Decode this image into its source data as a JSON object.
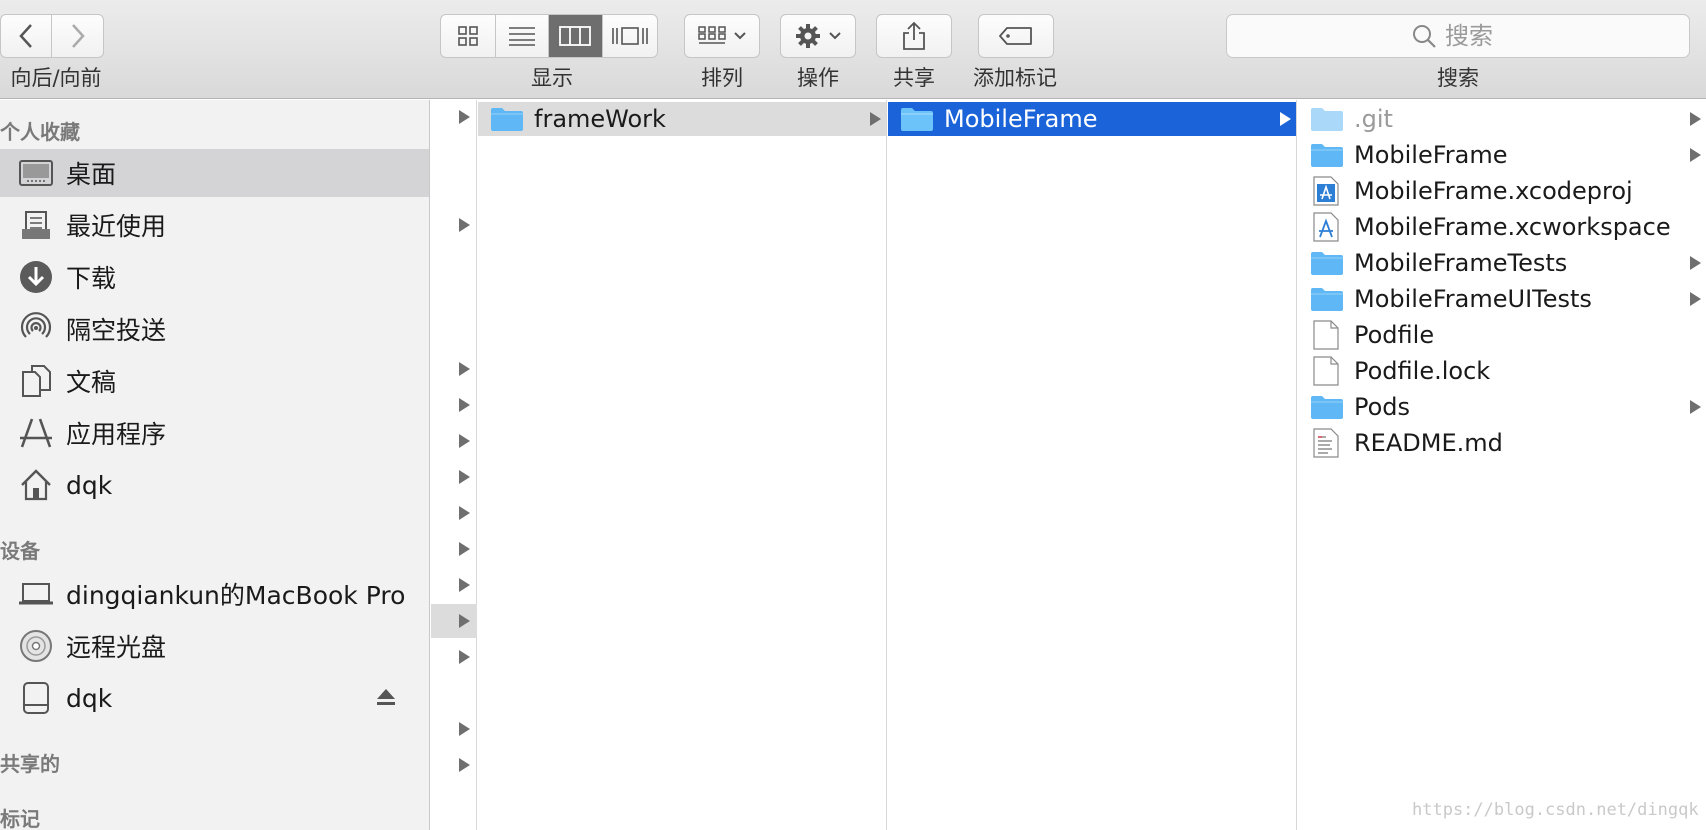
{
  "toolbar": {
    "nav_label": "向后/向前",
    "view_label": "显示",
    "arrange_label": "排列",
    "action_label": "操作",
    "share_label": "共享",
    "tag_label": "添加标记",
    "search_label": "搜索",
    "search_placeholder": "搜索"
  },
  "sidebar": {
    "favorites_header": "个人收藏",
    "favorites": [
      {
        "label": "桌面",
        "icon": "desktop-icon"
      },
      {
        "label": "最近使用",
        "icon": "recents-icon"
      },
      {
        "label": "下载",
        "icon": "downloads-icon"
      },
      {
        "label": "隔空投送",
        "icon": "airdrop-icon"
      },
      {
        "label": "文稿",
        "icon": "documents-icon"
      },
      {
        "label": "应用程序",
        "icon": "applications-icon"
      },
      {
        "label": "dqk",
        "icon": "home-icon"
      }
    ],
    "devices_header": "设备",
    "devices": [
      {
        "label": "dingqiankun的MacBook Pro",
        "icon": "laptop-icon"
      },
      {
        "label": "远程光盘",
        "icon": "disc-icon"
      },
      {
        "label": "dqk",
        "icon": "drive-icon"
      }
    ],
    "shared_header": "共享的",
    "tags_header": "标记"
  },
  "column2": {
    "items": [
      {
        "name": "frameWork"
      }
    ]
  },
  "column3": {
    "items": [
      {
        "name": "MobileFrame"
      }
    ]
  },
  "column4": {
    "items": [
      {
        "name": ".git",
        "kind": "folder"
      },
      {
        "name": "MobileFrame",
        "kind": "folder"
      },
      {
        "name": "MobileFrame.xcodeproj",
        "kind": "xcode"
      },
      {
        "name": "MobileFrame.xcworkspace",
        "kind": "xcode"
      },
      {
        "name": "MobileFrameTests",
        "kind": "folder"
      },
      {
        "name": "MobileFrameUITests",
        "kind": "folder"
      },
      {
        "name": "Podfile",
        "kind": "file"
      },
      {
        "name": "Podfile.lock",
        "kind": "file"
      },
      {
        "name": "Pods",
        "kind": "folder"
      },
      {
        "name": "README.md",
        "kind": "text"
      }
    ]
  },
  "watermark": "https://blog.csdn.net/dingqk",
  "colors": {
    "selection_blue": "#1a63d8",
    "folder_blue": "#5fb7f5"
  }
}
